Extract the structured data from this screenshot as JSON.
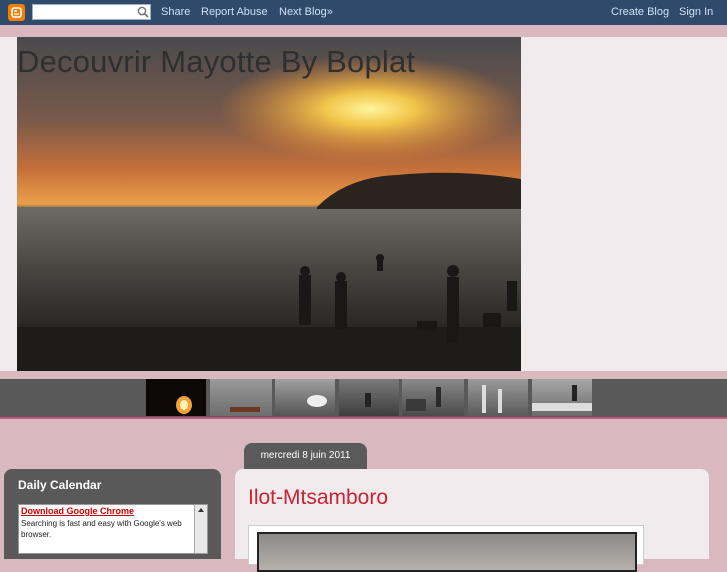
{
  "navbar": {
    "search_value": "",
    "links": [
      "Share",
      "Report Abuse",
      "Next Blog»"
    ],
    "right_links": [
      "Create Blog",
      "Sign In"
    ],
    "logo_icon": "blogger-logo-icon",
    "search_icon": "search-icon"
  },
  "header": {
    "title": "Decouvrir Mayotte By Boplat"
  },
  "post": {
    "date": "mercredi 8 juin 2011",
    "title": "Ilot-Mtsamboro"
  },
  "sidebar": {
    "widget_title": "Daily Calendar",
    "ad_link": "Download Google Chrome",
    "ad_text": "Searching is fast and easy with Google's web browser."
  },
  "colors": {
    "navbar": "#2f4a6b",
    "page_background": "#d9b8bf",
    "post_title": "#cc2233",
    "strip": "#595959"
  }
}
